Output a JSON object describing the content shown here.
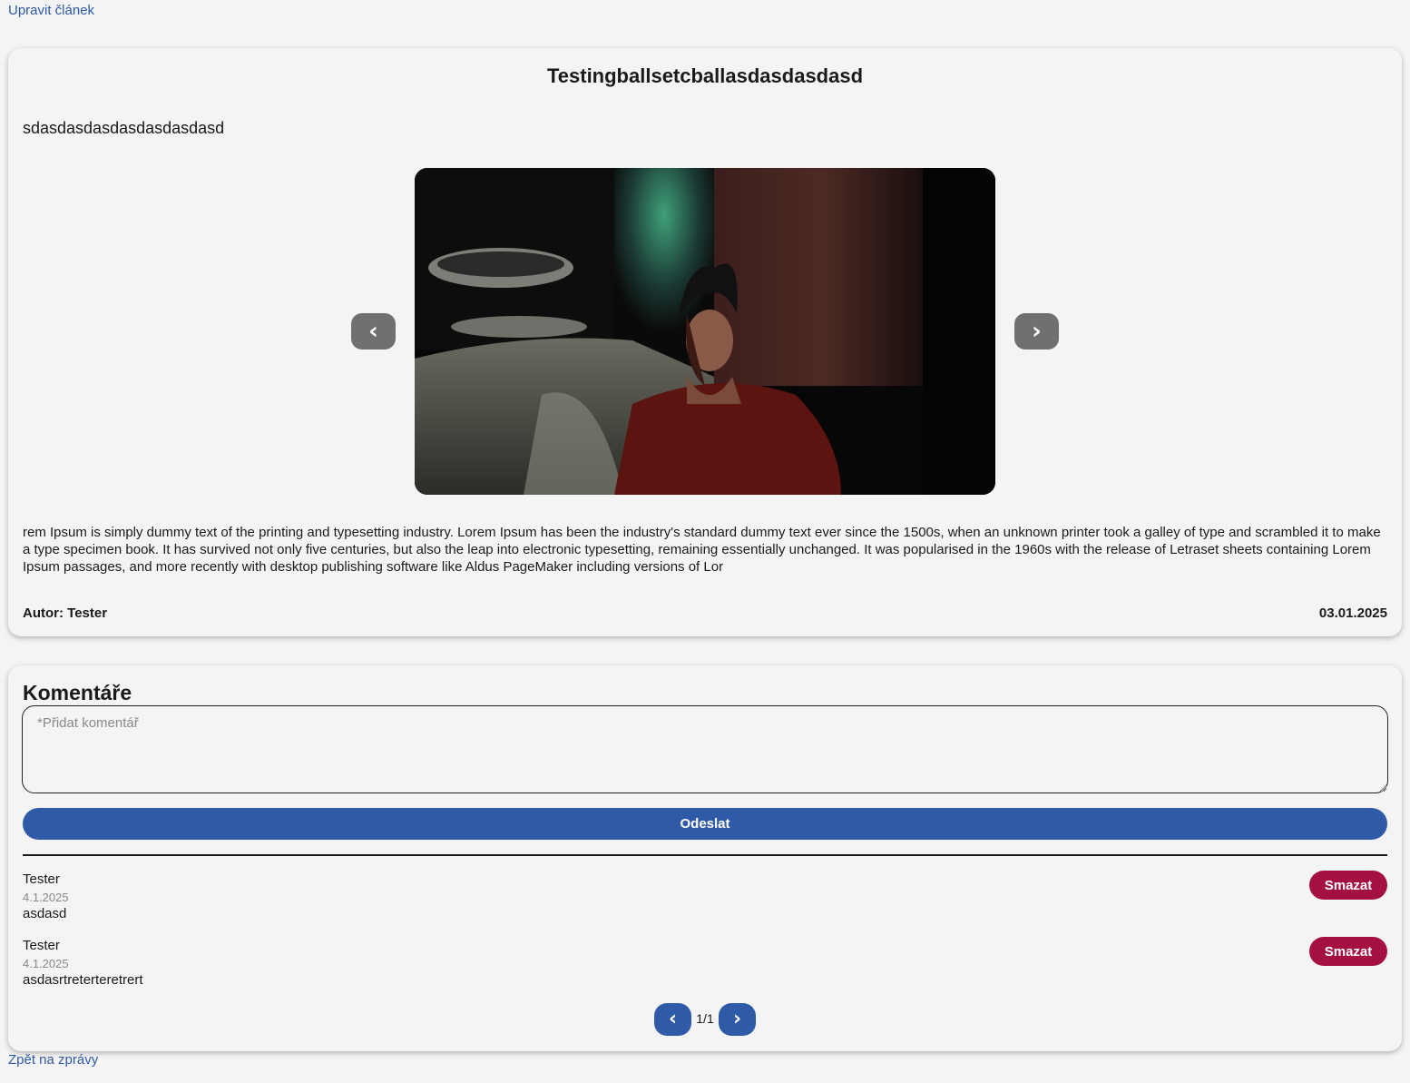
{
  "nav": {
    "edit_link": "Upravit článek",
    "back_link": "Zpět na zprávy"
  },
  "article": {
    "title": "Testingballsetcballasdasdasdasd",
    "subtitle": "sdasdasdasdasdasdasdasd",
    "body": "rem Ipsum is simply dummy text of the printing and typesetting industry. Lorem Ipsum has been the industry's standard dummy text ever since the 1500s, when an unknown printer took a galley of type and scrambled it to make a type specimen book. It has survived not only five centuries, but also the leap into electronic typesetting, remaining essentially unchanged. It was popularised in the 1960s with the release of Letraset sheets containing Lorem Ipsum passages, and more recently with desktop publishing software like Aldus PageMaker including versions of Lor",
    "author": "Autor: Tester",
    "date": "03.01.2025",
    "carousel": {
      "prev_icon": "chevron-left-icon",
      "next_icon": "chevron-right-icon",
      "prev_glyph": "‹",
      "next_glyph": "›"
    }
  },
  "comments": {
    "heading": "Komentáře",
    "input_placeholder": "*Přidat komentář",
    "input_value": "",
    "submit_label": "Odeslat",
    "items": [
      {
        "author": "Tester",
        "date": "4.1.2025",
        "text": "asdasd",
        "delete_label": "Smazat"
      },
      {
        "author": "Tester",
        "date": "4.1.2025",
        "text": "asdasrtreterteretrert",
        "delete_label": "Smazat"
      }
    ],
    "pagination": {
      "indicator": "1/1",
      "prev_glyph": "‹",
      "next_glyph": "›"
    }
  },
  "colors": {
    "background": "#f4f4f4",
    "primary": "#2f5aa8",
    "danger": "#a4103f",
    "carousel_button": "#707070"
  }
}
